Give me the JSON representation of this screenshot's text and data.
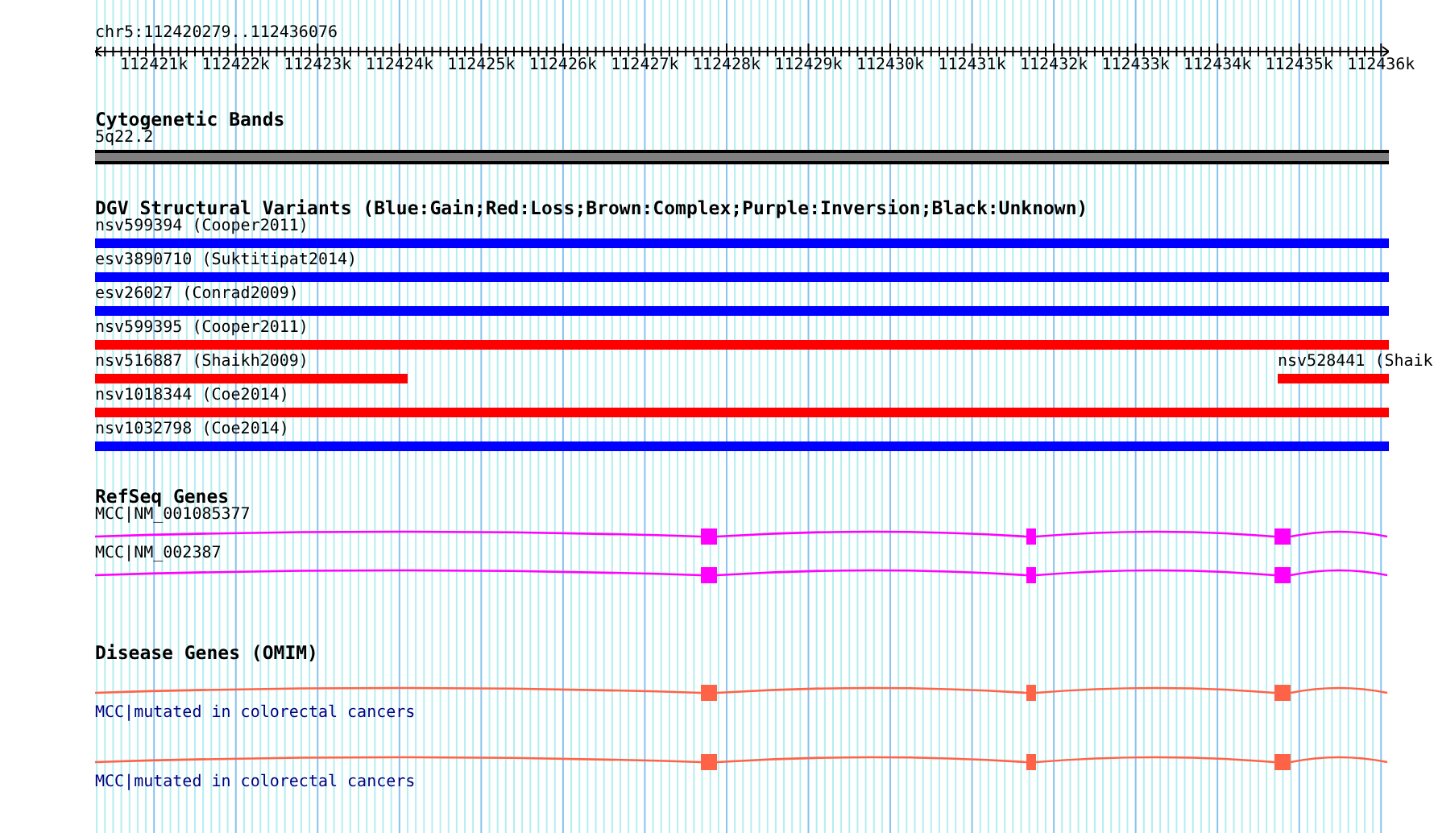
{
  "location": "chr5:112420279..112436076",
  "ruler_ticks": [
    "112421k",
    "112422k",
    "112423k",
    "112424k",
    "112425k",
    "112426k",
    "112427k",
    "112428k",
    "112429k",
    "112430k",
    "112431k",
    "112432k",
    "112433k",
    "112434k",
    "112435k",
    "112436k"
  ],
  "tracks": [
    {
      "kind": "band",
      "title": "Cytogenetic Bands",
      "features": [
        {
          "label": "5q22.2"
        }
      ]
    },
    {
      "kind": "variants",
      "title": "DGV Structural Variants (Blue:Gain;Red:Loss;Brown:Complex;Purple:Inversion;Black:Unknown)",
      "rows": [
        {
          "features": [
            {
              "label": "nsv599394 (Cooper2011)",
              "color": "#0000ff",
              "kind": "full"
            }
          ]
        },
        {
          "features": [
            {
              "label": "esv3890710 (Suktitipat2014)",
              "color": "#0000ff",
              "kind": "full"
            }
          ]
        },
        {
          "features": [
            {
              "label": "esv26027 (Conrad2009)",
              "color": "#0000ff",
              "kind": "full"
            }
          ]
        },
        {
          "features": [
            {
              "label": "nsv599395 (Cooper2011)",
              "color": "#ff0000",
              "kind": "full"
            }
          ]
        },
        {
          "features": [
            {
              "label": "nsv516887 (Shaikh2009)",
              "color": "#ff0000",
              "kind": "start"
            },
            {
              "label": "nsv528441 (Shaik",
              "color": "#ff0000",
              "kind": "end"
            }
          ]
        },
        {
          "features": [
            {
              "label": "nsv1018344 (Coe2014)",
              "color": "#ff0000",
              "kind": "full"
            }
          ]
        },
        {
          "features": [
            {
              "label": "nsv1032798 (Coe2014)",
              "color": "#0000ff",
              "kind": "full"
            }
          ]
        }
      ]
    },
    {
      "kind": "genes",
      "title": "RefSeq Genes",
      "features": [
        {
          "label": "MCC|NM_001085377"
        },
        {
          "label": "MCC|NM_002387"
        }
      ]
    },
    {
      "kind": "disease",
      "title": "Disease Genes (OMIM)",
      "features": [
        {
          "label": "MCC|mutated in colorectal cancers"
        },
        {
          "label": "MCC|mutated in colorectal cancers"
        }
      ]
    }
  ]
}
